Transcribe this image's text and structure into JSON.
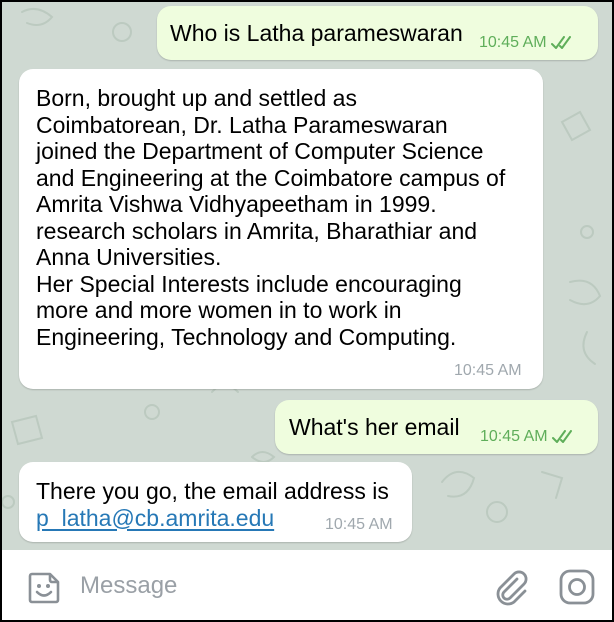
{
  "messages": [
    {
      "id": "m1",
      "direction": "outgoing",
      "text": "Who is Latha parameswaran",
      "time": "10:45 AM",
      "status": "read"
    },
    {
      "id": "m2",
      "direction": "incoming",
      "lines": [
        "Born, brought up and settled as",
        "Coimbatorean, Dr. Latha Parameswaran",
        "joined the Department of Computer Science",
        "and Engineering at the Coimbatore campus of",
        "Amrita Vishwa Vidhyapeetham in 1999.",
        "research scholars in Amrita, Bharathiar and",
        "Anna Universities.",
        "Her Special Interests include encouraging",
        "more and more women in to work in",
        "Engineering, Technology and Computing."
      ],
      "time": "10:45 AM"
    },
    {
      "id": "m3",
      "direction": "outgoing",
      "text": "What's her email",
      "time": "10:45 AM",
      "status": "read"
    },
    {
      "id": "m4",
      "direction": "incoming",
      "lines": [
        "There you go, the email address is"
      ],
      "link": "p_latha@cb.amrita.edu",
      "time": "10:45 AM"
    }
  ],
  "composer": {
    "placeholder": "Message",
    "emoji_icon": "sticker-emoji-icon",
    "attach_icon": "paperclip-icon",
    "camera_icon": "camera-icon"
  },
  "colors": {
    "background": "#cfd9d2",
    "outgoing_bubble": "#effdde",
    "incoming_bubble": "#ffffff",
    "outgoing_meta": "#5fae5a",
    "incoming_meta": "#a0a8ae",
    "link": "#2678b6"
  }
}
